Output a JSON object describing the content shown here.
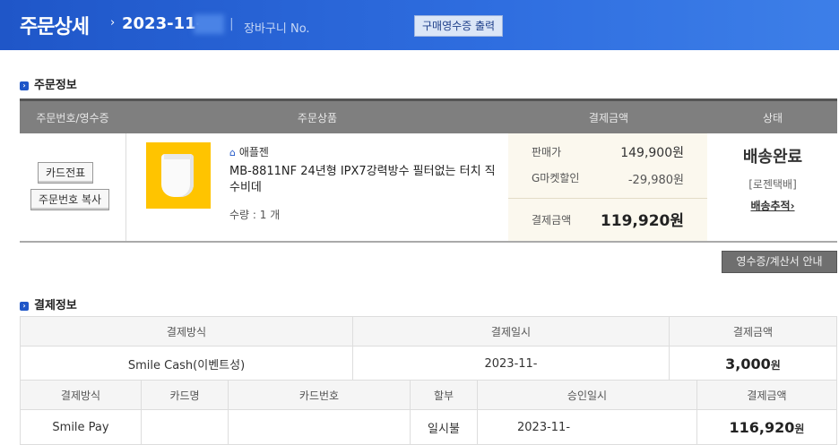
{
  "header": {
    "title": "주문상세",
    "arrow": "›",
    "date": "2023-11-",
    "separator": "|",
    "cart_label": "장바구니 No.",
    "receipt_button": "구매영수증 출력"
  },
  "order_section": {
    "title": "주문정보",
    "columns": [
      "주문번호/영수증",
      "주문상품",
      "결제금액",
      "상태"
    ],
    "card_slip_button": "카드전표",
    "copy_order_button": "주문번호 복사",
    "product": {
      "seller_icon": "home-icon",
      "seller": "애플젠",
      "name": "MB-8811NF 24년형 IPX7강력방수 필터없는 터치 직수비데",
      "quantity": "수량 : 1 개"
    },
    "price": {
      "sale_label": "판매가",
      "sale_value": "149,900원",
      "discount_label": "G마켓할인",
      "discount_value": "-29,980원",
      "total_label": "결제금액",
      "total_value": "119,920원"
    },
    "status": {
      "main": "배송완료",
      "courier": "[로젠택배]",
      "track": "배송추적›"
    },
    "receipt_guide_button": "영수증/계산서 안내"
  },
  "payment_section": {
    "title": "결제정보",
    "table1": {
      "headers": [
        "결제방식",
        "결제일시",
        "결제금액"
      ],
      "row": {
        "method": "Smile Cash(이벤트성)",
        "datetime": "2023-11-",
        "amount": "3,000",
        "unit": "원"
      }
    },
    "table2": {
      "headers": [
        "결제방식",
        "카드명",
        "카드번호",
        "할부",
        "승인일시",
        "결제금액"
      ],
      "row": {
        "method": "Smile Pay",
        "card_name": "",
        "card_number": "",
        "installment": "일시불",
        "approved": "2023-11-",
        "amount": "116,920",
        "unit": "원"
      }
    }
  },
  "colors": {
    "header_blue": "#1f56c8",
    "table_head": "#7f7f7f",
    "price_bg": "#fbf8ee"
  }
}
